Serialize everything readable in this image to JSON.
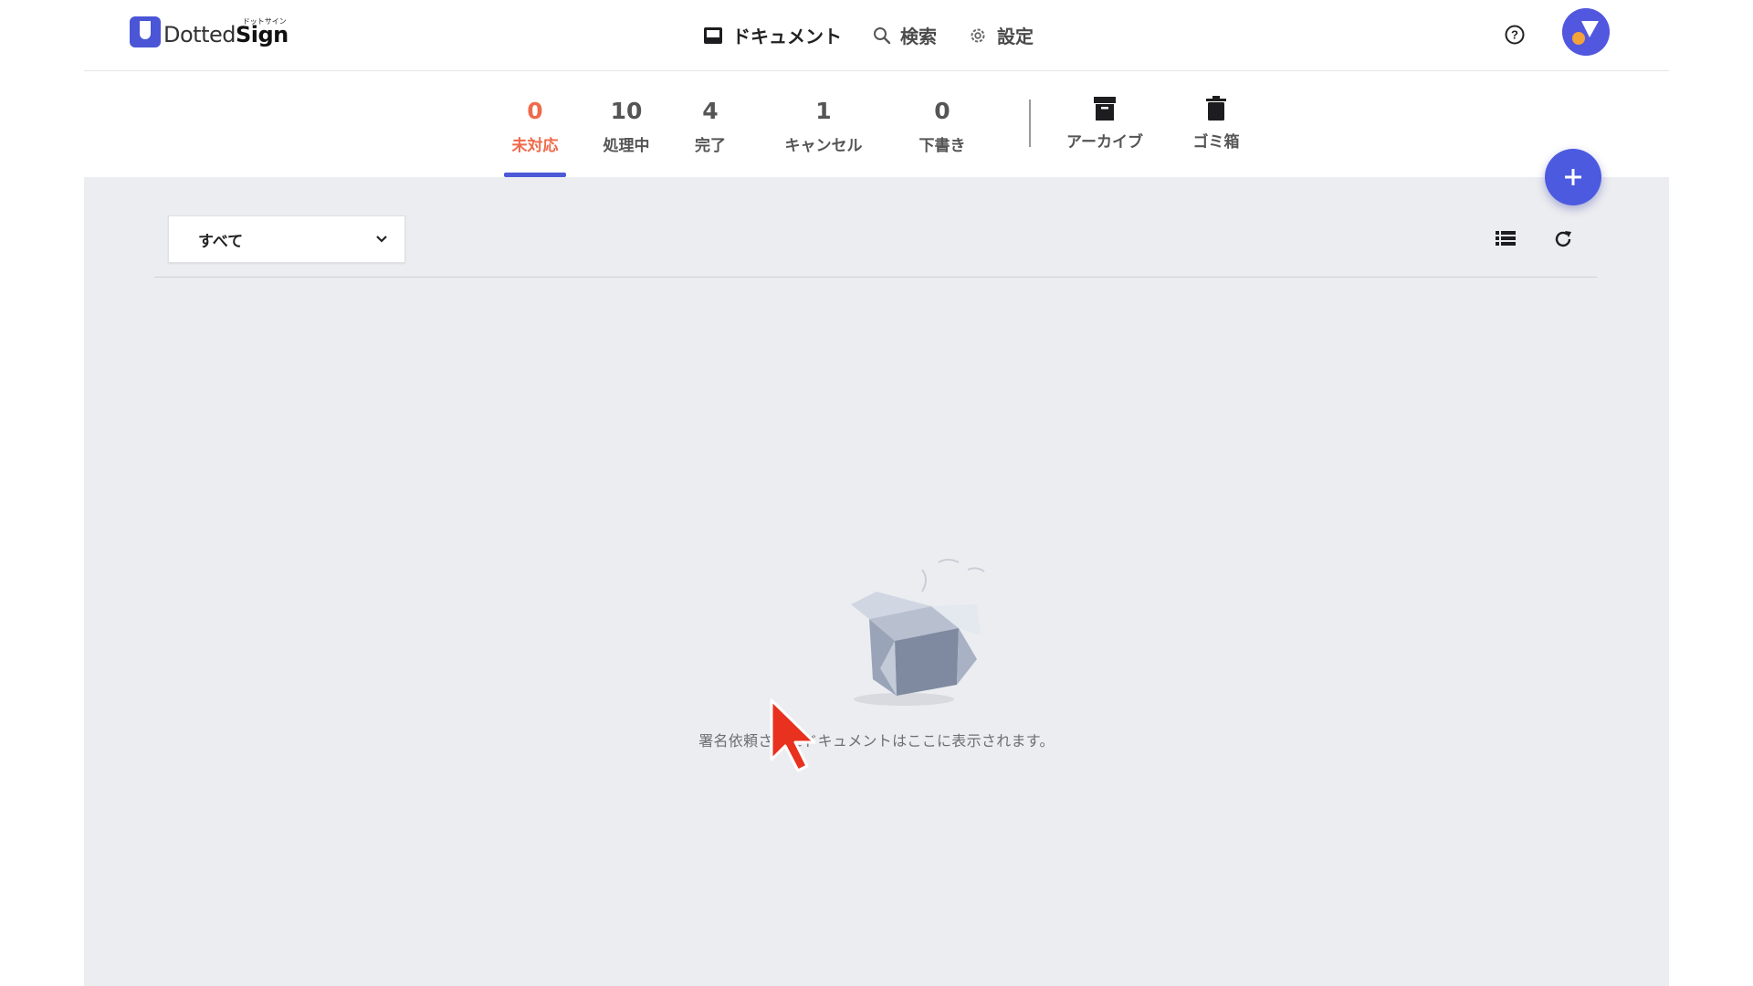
{
  "header": {
    "logo": {
      "kana": "ドットサイン",
      "text_light": "Dotted",
      "text_bold": "Sign"
    },
    "nav": [
      {
        "label": "ドキュメント",
        "icon": "inbox-icon"
      },
      {
        "label": "検索",
        "icon": "search-icon"
      },
      {
        "label": "設定",
        "icon": "gear-icon"
      }
    ],
    "help_icon": "help-circle-icon",
    "avatar_icon": "avatar"
  },
  "tabs": [
    {
      "count": "0",
      "label": "未対応",
      "active": true
    },
    {
      "count": "10",
      "label": "処理中"
    },
    {
      "count": "4",
      "label": "完了"
    },
    {
      "count": "1",
      "label": "キャンセル"
    },
    {
      "count": "0",
      "label": "下書き"
    }
  ],
  "extra_tabs": [
    {
      "label": "アーカイブ",
      "icon": "archive-icon"
    },
    {
      "label": "ゴミ箱",
      "icon": "trash-icon"
    }
  ],
  "filter": {
    "value": "すべて",
    "icon": "chevron-down-icon"
  },
  "toolbar": {
    "list_icon": "list-view-icon",
    "refresh_icon": "refresh-icon"
  },
  "fab": {
    "icon": "plus-icon"
  },
  "empty_state": {
    "message": "署名依頼されたドキュメントはここに表示されます。",
    "icon": "empty-box-illustration"
  },
  "colors": {
    "accent": "#4c5ae0",
    "active_tab": "#ef6a4b",
    "background": "#ecedf0"
  }
}
